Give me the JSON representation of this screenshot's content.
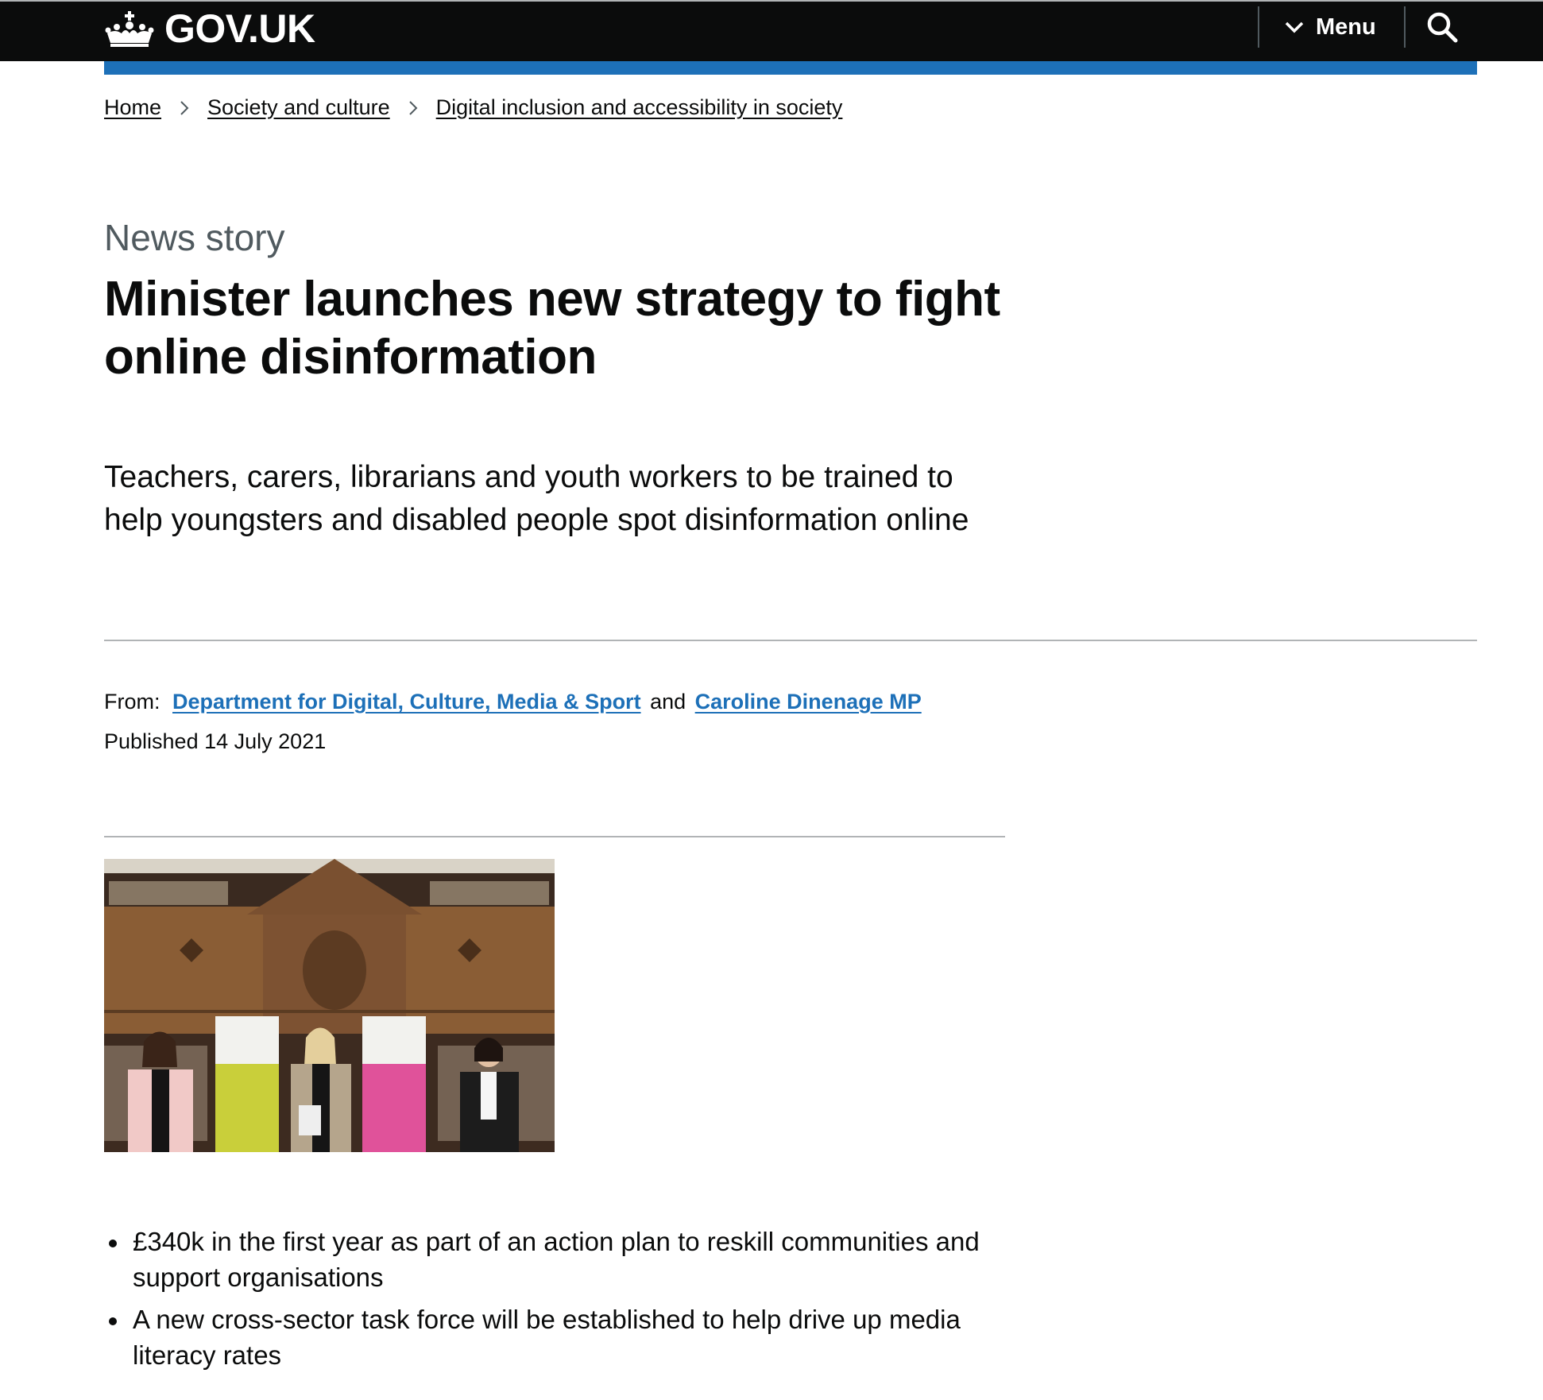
{
  "header": {
    "logo_text": "GOV.UK",
    "menu_label": "Menu"
  },
  "breadcrumb": [
    "Home",
    "Society and culture",
    "Digital inclusion and accessibility in society"
  ],
  "article": {
    "caption": "News story",
    "title": "Minister launches new strategy to fight online disinformation",
    "lead": "Teachers, carers, librarians and youth workers to be trained to help youngsters and disabled people spot disinformation online",
    "from_label": "From:",
    "from_org": "Department for Digital, Culture, Media & Sport",
    "from_and": "and",
    "from_person": "Caroline Dinenage MP",
    "published_label": "Published",
    "published_date": "14 July 2021",
    "bullets": [
      "£340k in the first year as part of an action plan to reskill communities and support organisations",
      "A new cross-sector task force will be established to help drive up media literacy rates"
    ]
  },
  "colors": {
    "header_bg": "#0b0c0c",
    "brand_blue": "#1d70b8",
    "secondary_text": "#505a5f",
    "rule": "#b1b4b6"
  },
  "icons": {
    "logo": "crown-icon",
    "menu": "chevron-down-icon",
    "search": "search-icon",
    "breadcrumb_separator": "chevron-right-icon"
  }
}
